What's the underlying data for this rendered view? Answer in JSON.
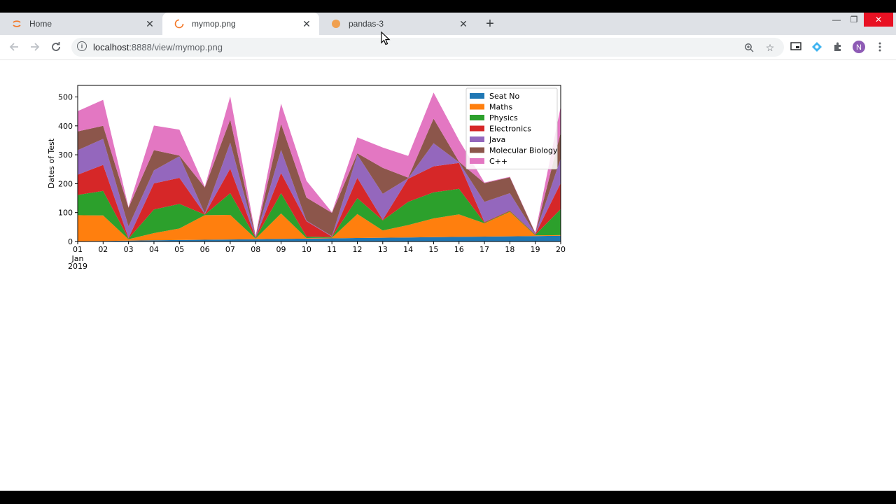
{
  "browser": {
    "tabs": [
      {
        "title": "Home",
        "active": false
      },
      {
        "title": "mymop.png",
        "active": true
      },
      {
        "title": "pandas-3",
        "active": false
      }
    ],
    "new_tab_symbol": "+",
    "url_host": "localhost",
    "url_rest": ":8888/view/mymop.png",
    "window_controls": {
      "minimize": "—",
      "restore": "❐",
      "close": "✕"
    },
    "icons": [
      "back-icon",
      "forward-icon",
      "reload-icon",
      "info-icon",
      "zoom-icon",
      "star-icon",
      "cast-icon",
      "extension-icon",
      "puzzle-icon",
      "profile-icon",
      "menu-icon"
    ]
  },
  "chart_data": {
    "type": "area",
    "stacked": true,
    "title": "",
    "xlabel": "",
    "ylabel": "Dates of Test",
    "ylim": [
      0,
      540
    ],
    "yticks": [
      0,
      100,
      200,
      300,
      400,
      500
    ],
    "x_ticks": [
      "01",
      "02",
      "03",
      "04",
      "05",
      "06",
      "07",
      "08",
      "09",
      "10",
      "11",
      "12",
      "13",
      "14",
      "15",
      "16",
      "17",
      "18",
      "19",
      "20"
    ],
    "x_sublabel_1": "Jan",
    "x_sublabel_2": "2019",
    "legend_position": "top-right",
    "grid": false,
    "series": [
      {
        "name": "Seat No",
        "color": "#1f77b4",
        "values": [
          1,
          2,
          3,
          4,
          5,
          6,
          7,
          8,
          9,
          10,
          11,
          12,
          13,
          14,
          15,
          16,
          17,
          18,
          19,
          20
        ]
      },
      {
        "name": "Maths",
        "color": "#ff7f0e",
        "values": [
          90,
          88,
          5,
          25,
          40,
          85,
          85,
          2,
          88,
          2,
          2,
          83,
          25,
          43,
          65,
          78,
          46,
          85,
          2,
          2
        ]
      },
      {
        "name": "Physics",
        "color": "#2ca02c",
        "values": [
          70,
          85,
          2,
          82,
          85,
          2,
          75,
          2,
          70,
          5,
          2,
          55,
          35,
          80,
          90,
          88,
          2,
          2,
          2,
          90
        ]
      },
      {
        "name": "Electronics",
        "color": "#d62728",
        "values": [
          70,
          90,
          2,
          90,
          90,
          2,
          85,
          2,
          70,
          53,
          2,
          70,
          2,
          80,
          90,
          90,
          2,
          2,
          2,
          90
        ]
      },
      {
        "name": "Java",
        "color": "#9467bd",
        "values": [
          85,
          90,
          40,
          45,
          75,
          2,
          90,
          2,
          80,
          2,
          2,
          80,
          90,
          2,
          80,
          2,
          70,
          60,
          2,
          85
        ]
      },
      {
        "name": "Molecular Biology",
        "color": "#8c564b",
        "values": [
          65,
          45,
          65,
          70,
          2,
          90,
          80,
          2,
          90,
          80,
          80,
          5,
          90,
          2,
          85,
          2,
          65,
          55,
          2,
          90
        ]
      },
      {
        "name": "C++",
        "color": "#e377c2",
        "values": [
          70,
          90,
          2,
          85,
          90,
          2,
          80,
          2,
          70,
          58,
          2,
          55,
          70,
          75,
          90,
          75,
          2,
          2,
          2,
          90
        ]
      }
    ]
  }
}
